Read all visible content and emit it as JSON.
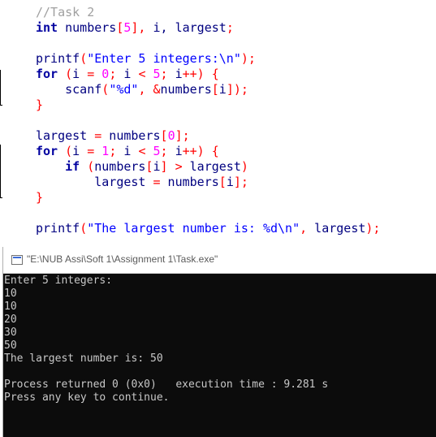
{
  "editor": {
    "lines": [
      [
        {
          "t": "//Task 2",
          "c": "comment"
        }
      ],
      [
        {
          "t": "int",
          "c": "kw"
        },
        {
          "t": " numbers",
          "c": "id"
        },
        {
          "t": "[",
          "c": "op"
        },
        {
          "t": "5",
          "c": "num"
        },
        {
          "t": "],",
          "c": "op"
        },
        {
          "t": " i, largest",
          "c": "id"
        },
        {
          "t": ";",
          "c": "op"
        }
      ],
      [],
      [
        {
          "t": "printf",
          "c": "id"
        },
        {
          "t": "(",
          "c": "op"
        },
        {
          "t": "\"Enter 5 integers:\\n\"",
          "c": "str"
        },
        {
          "t": ");",
          "c": "op"
        }
      ],
      [
        {
          "t": "for",
          "c": "kw"
        },
        {
          "t": " ",
          "c": "id"
        },
        {
          "t": "(",
          "c": "op"
        },
        {
          "t": "i ",
          "c": "id"
        },
        {
          "t": "=",
          "c": "op"
        },
        {
          "t": " ",
          "c": "id"
        },
        {
          "t": "0",
          "c": "num"
        },
        {
          "t": ";",
          "c": "op"
        },
        {
          "t": " i ",
          "c": "id"
        },
        {
          "t": "<",
          "c": "op"
        },
        {
          "t": " ",
          "c": "id"
        },
        {
          "t": "5",
          "c": "num"
        },
        {
          "t": ";",
          "c": "op"
        },
        {
          "t": " i",
          "c": "id"
        },
        {
          "t": "++)",
          "c": "op"
        },
        {
          "t": " ",
          "c": "id"
        },
        {
          "t": "{",
          "c": "op"
        }
      ],
      [
        {
          "t": "    scanf",
          "c": "id"
        },
        {
          "t": "(",
          "c": "op"
        },
        {
          "t": "\"%d\"",
          "c": "str"
        },
        {
          "t": ",",
          "c": "op"
        },
        {
          "t": " ",
          "c": "id"
        },
        {
          "t": "&",
          "c": "op"
        },
        {
          "t": "numbers",
          "c": "id"
        },
        {
          "t": "[",
          "c": "op"
        },
        {
          "t": "i",
          "c": "id"
        },
        {
          "t": "]);",
          "c": "op"
        }
      ],
      [
        {
          "t": "}",
          "c": "op"
        }
      ],
      [],
      [
        {
          "t": "largest ",
          "c": "id"
        },
        {
          "t": "=",
          "c": "op"
        },
        {
          "t": " numbers",
          "c": "id"
        },
        {
          "t": "[",
          "c": "op"
        },
        {
          "t": "0",
          "c": "num"
        },
        {
          "t": "];",
          "c": "op"
        }
      ],
      [
        {
          "t": "for",
          "c": "kw"
        },
        {
          "t": " ",
          "c": "id"
        },
        {
          "t": "(",
          "c": "op"
        },
        {
          "t": "i ",
          "c": "id"
        },
        {
          "t": "=",
          "c": "op"
        },
        {
          "t": " ",
          "c": "id"
        },
        {
          "t": "1",
          "c": "num"
        },
        {
          "t": ";",
          "c": "op"
        },
        {
          "t": " i ",
          "c": "id"
        },
        {
          "t": "<",
          "c": "op"
        },
        {
          "t": " ",
          "c": "id"
        },
        {
          "t": "5",
          "c": "num"
        },
        {
          "t": ";",
          "c": "op"
        },
        {
          "t": " i",
          "c": "id"
        },
        {
          "t": "++)",
          "c": "op"
        },
        {
          "t": " ",
          "c": "id"
        },
        {
          "t": "{",
          "c": "op"
        }
      ],
      [
        {
          "t": "    ",
          "c": "id"
        },
        {
          "t": "if",
          "c": "kw"
        },
        {
          "t": " ",
          "c": "id"
        },
        {
          "t": "(",
          "c": "op"
        },
        {
          "t": "numbers",
          "c": "id"
        },
        {
          "t": "[",
          "c": "op"
        },
        {
          "t": "i",
          "c": "id"
        },
        {
          "t": "]",
          "c": "op"
        },
        {
          "t": " ",
          "c": "id"
        },
        {
          "t": ">",
          "c": "op"
        },
        {
          "t": " largest",
          "c": "id"
        },
        {
          "t": ")",
          "c": "op"
        }
      ],
      [
        {
          "t": "        largest ",
          "c": "id"
        },
        {
          "t": "=",
          "c": "op"
        },
        {
          "t": " numbers",
          "c": "id"
        },
        {
          "t": "[",
          "c": "op"
        },
        {
          "t": "i",
          "c": "id"
        },
        {
          "t": "];",
          "c": "op"
        }
      ],
      [
        {
          "t": "}",
          "c": "op"
        }
      ],
      [],
      [
        {
          "t": "printf",
          "c": "id"
        },
        {
          "t": "(",
          "c": "op"
        },
        {
          "t": "\"The largest number is: %d\\n\"",
          "c": "str"
        },
        {
          "t": ",",
          "c": "op"
        },
        {
          "t": " largest",
          "c": "id"
        },
        {
          "t": ");",
          "c": "op"
        }
      ]
    ]
  },
  "console": {
    "title": "\"E:\\NUB Assi\\Soft 1\\Assignment 1\\Task.exe\"",
    "output": [
      "Enter 5 integers:",
      "10",
      "10",
      "20",
      "30",
      "50",
      "The largest number is: 50",
      "",
      "Process returned 0 (0x0)   execution time : 9.281 s",
      "Press any key to continue."
    ]
  }
}
